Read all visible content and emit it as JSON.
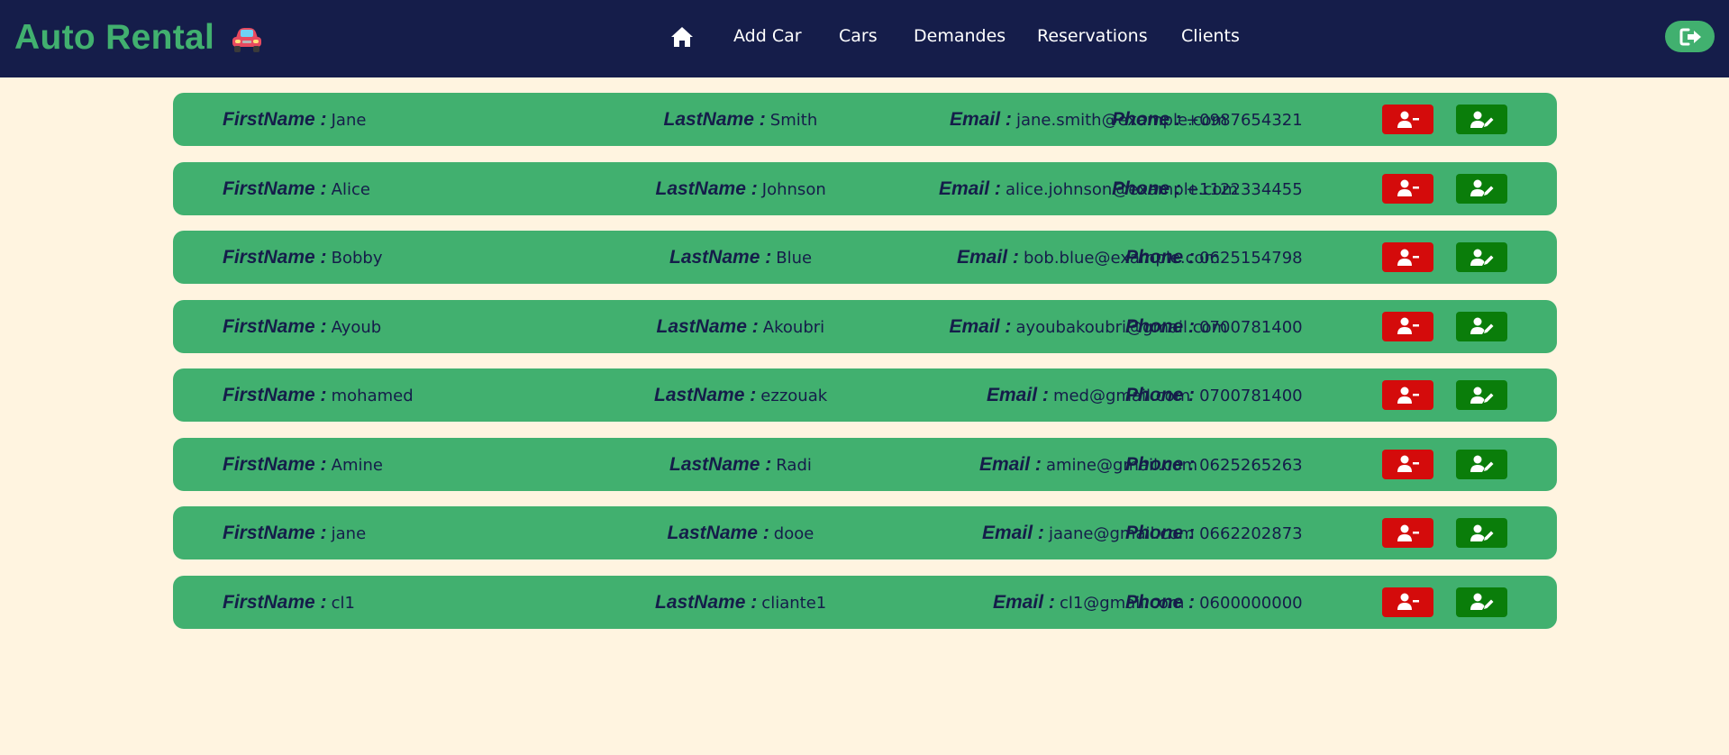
{
  "header": {
    "brand": "Auto Rental",
    "nav": [
      {
        "label": "Add Car"
      },
      {
        "label": "Cars"
      },
      {
        "label": "Demandes"
      },
      {
        "label": "Reservations"
      },
      {
        "label": "Clients"
      }
    ],
    "icons": {
      "home": "home-icon",
      "car": "car-icon",
      "logout": "sign-out-icon"
    }
  },
  "labels": {
    "firstname": "FirstName :",
    "lastname": "LastName :",
    "email": "Email :",
    "phone": "Phone :"
  },
  "clients": [
    {
      "first": "Jane",
      "last": "Smith",
      "email": "jane.smith@example.com",
      "phone": "+0987654321"
    },
    {
      "first": "Alice",
      "last": "Johnson",
      "email": "alice.johnson@example.com",
      "phone": "+1122334455"
    },
    {
      "first": "Bobby",
      "last": "Blue",
      "email": "bob.blue@example.com",
      "phone": "0625154798"
    },
    {
      "first": "Ayoub",
      "last": "Akoubri",
      "email": "ayoubakoubri@gmail.com",
      "phone": "0700781400"
    },
    {
      "first": "mohamed",
      "last": "ezzouak",
      "email": "med@gmail.com",
      "phone": "0700781400"
    },
    {
      "first": "Amine",
      "last": "Radi",
      "email": "amine@gmail.com",
      "phone": "0625265263"
    },
    {
      "first": "jane",
      "last": "dooe",
      "email": "jaane@gmail.com",
      "phone": "0662202873"
    },
    {
      "first": "cl1",
      "last": "cliante1",
      "email": "cl1@gmail.com",
      "phone": "0600000000"
    }
  ],
  "colors": {
    "navbar": "#151d4a",
    "accent": "#41b06f",
    "background": "#fff4e0",
    "delete": "#d40b0b",
    "edit": "#0a7d0a"
  }
}
